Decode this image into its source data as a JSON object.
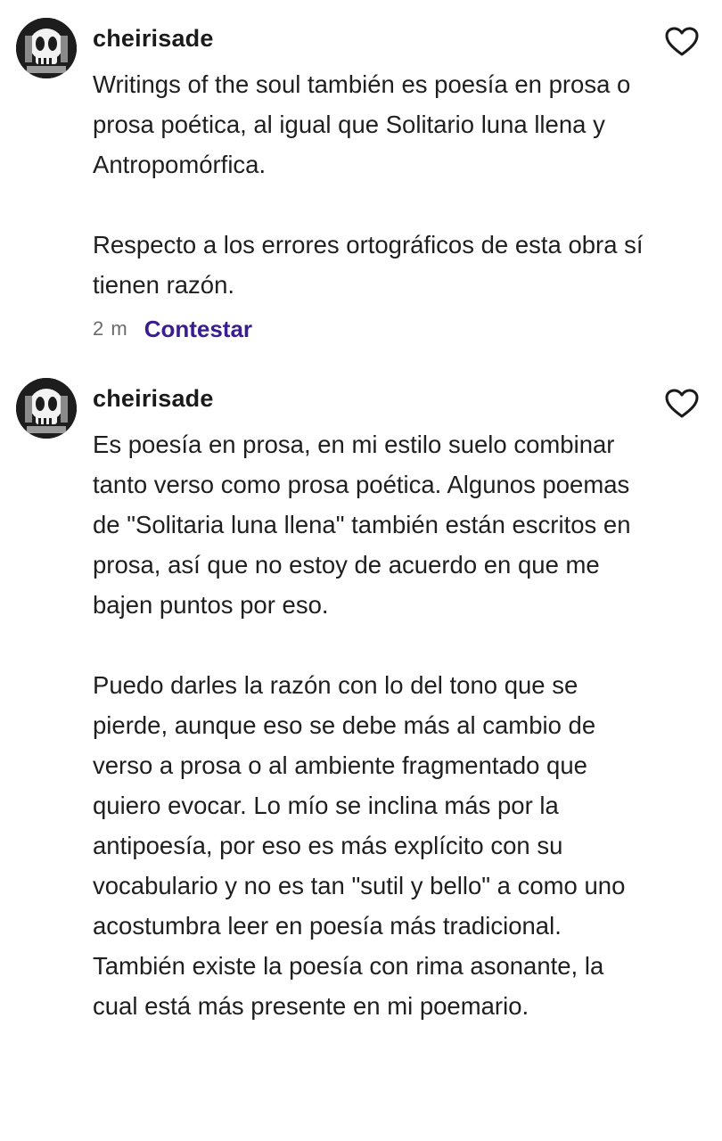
{
  "comments": [
    {
      "username": "cheirisade",
      "paragraphs": [
        "Writings of the soul también es poesía en prosa o prosa poética, al igual que Solitario luna llena y Antropomórfica.",
        "Respecto a los errores ortográficos de esta obra sí tienen razón."
      ],
      "time": "2 m",
      "reply_label": "Contestar"
    },
    {
      "username": "cheirisade",
      "paragraphs": [
        "Es poesía en prosa, en mi estilo suelo combinar tanto verso como prosa poética. Algunos poemas de \"Solitaria luna llena\" también están escritos en prosa, así que no estoy de acuerdo en que me bajen puntos por eso.",
        "Puedo darles la razón con lo del tono que se pierde, aunque eso se debe más al cambio de verso a prosa o al ambiente fragmentado que quiero evocar. Lo mío se inclina más por la antipoesía, por eso es más explícito con su vocabulario y no es tan \"sutil y bello\" a como uno acostumbra leer en poesía más tradicional. También existe la poesía con rima asonante, la cual está más presente en mi poemario."
      ]
    }
  ],
  "colors": {
    "reply_link": "#3a1e8f",
    "timestamp": "#6b6b6b",
    "text": "#1f1f1f"
  },
  "icons": {
    "avatar": "skull-avatar",
    "like": "heart-outline-icon"
  }
}
